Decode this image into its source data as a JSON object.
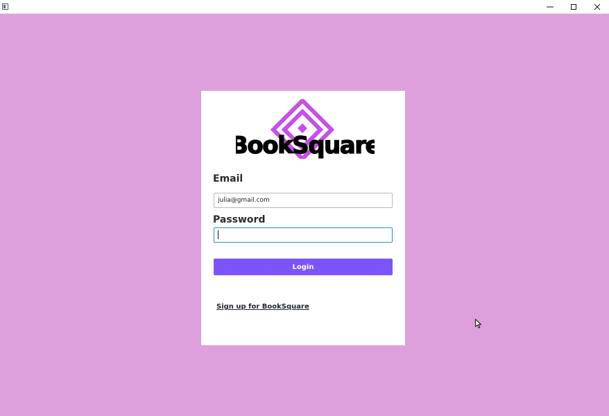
{
  "window": {
    "controls": [
      "minimize-icon",
      "maximize-icon",
      "close-icon"
    ]
  },
  "login_card": {
    "logo_text": "BookSquare",
    "email_label": "Email",
    "email_value": "julia@gmail.com",
    "password_label": "Password",
    "password_value": "",
    "login_button": "Login",
    "signup_link": "Sign up for BookSquare"
  },
  "colors": {
    "background": "#dda0dd",
    "accent": "#7b54fc",
    "logo_diamond": "#c94de8",
    "focus_border": "#1e8fd6"
  }
}
